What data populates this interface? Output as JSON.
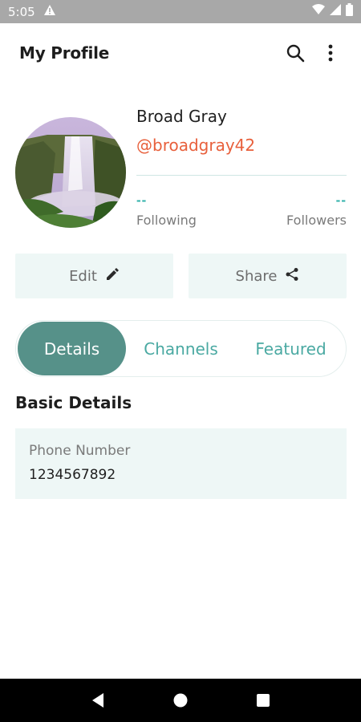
{
  "status_bar": {
    "time": "5:05",
    "icons": [
      "alert-icon",
      "wifi-icon",
      "signal-icon",
      "battery-icon"
    ]
  },
  "app_bar": {
    "title": "My Profile",
    "icons": [
      "search-icon",
      "more-vert-icon"
    ]
  },
  "profile": {
    "name": "Broad Gray",
    "handle": "@broadgray42",
    "following_value": "--",
    "following_label": "Following",
    "followers_value": "--",
    "followers_label": "Followers"
  },
  "actions": {
    "edit_label": "Edit",
    "share_label": "Share"
  },
  "tabs": [
    {
      "label": "Details",
      "active": true
    },
    {
      "label": "Channels",
      "active": false
    },
    {
      "label": "Featured",
      "active": false
    }
  ],
  "basic_details": {
    "title": "Basic Details",
    "phone_label": "Phone Number",
    "phone_value": "1234567892"
  },
  "colors": {
    "accent": "#569189",
    "handle": "#e8603c",
    "card_bg": "#eef7f6",
    "stat": "#2fb0aa"
  }
}
